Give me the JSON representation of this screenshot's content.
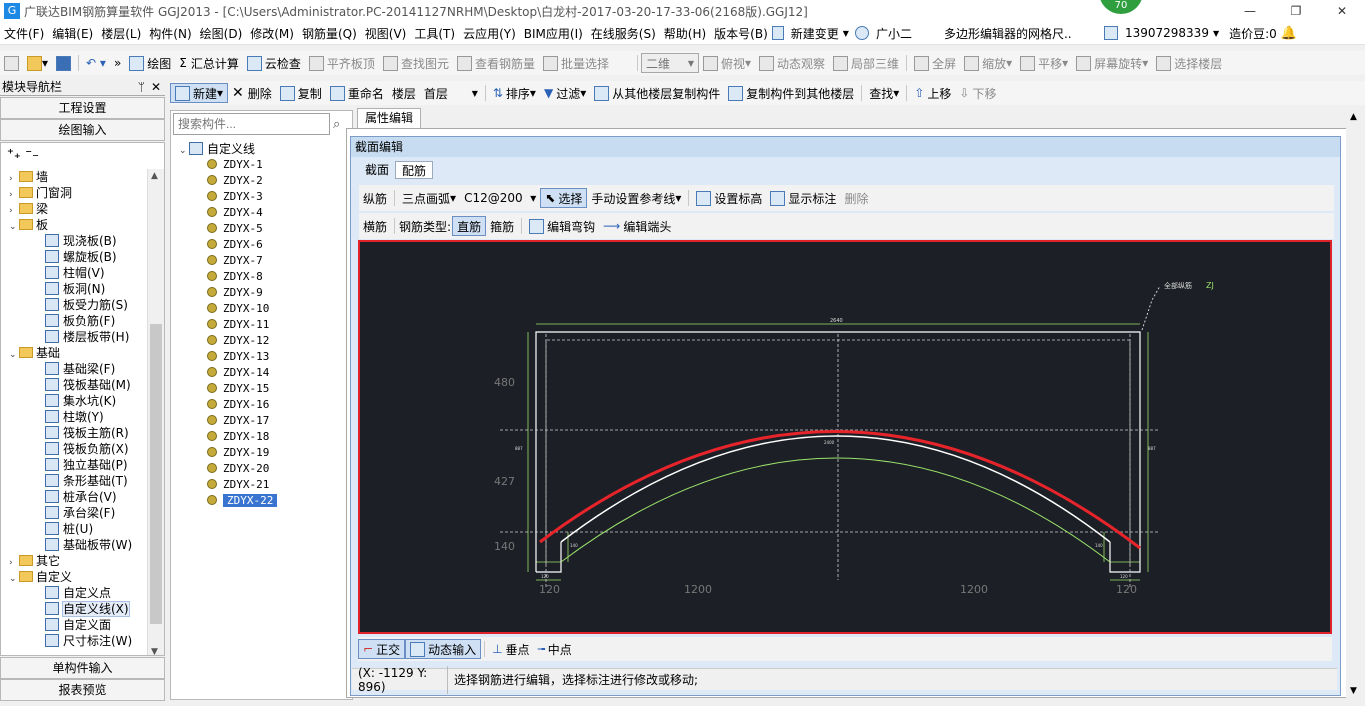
{
  "window": {
    "title": "广联达BIM钢筋算量软件 GGJ2013 - [C:\\Users\\Administrator.PC-20141127NRHM\\Desktop\\白龙村-2017-03-20-17-33-06(2168版).GGJ12]",
    "badge": "70",
    "min": "—",
    "restore": "❐",
    "close": "✕"
  },
  "menu": {
    "items": [
      "文件(F)",
      "编辑(E)",
      "楼层(L)",
      "构件(N)",
      "绘图(D)",
      "修改(M)",
      "钢筋量(Q)",
      "视图(V)",
      "工具(T)",
      "云应用(Y)",
      "BIM应用(I)",
      "在线服务(S)",
      "帮助(H)",
      "版本号(B)"
    ],
    "new_change": "新建变更",
    "assistant": "广小二",
    "marquee": "多边形编辑器的网格尺..",
    "phone": "13907298339",
    "beans": "造价豆:0"
  },
  "toolbar1": {
    "items": [
      "绘图",
      "汇总计算",
      "云检查",
      "平齐板顶",
      "查找图元",
      "查看钢筋量",
      "批量选择"
    ],
    "view_mode": "二维",
    "items2": [
      "俯视",
      "动态观察",
      "局部三维",
      "全屏",
      "缩放",
      "平移",
      "屏幕旋转",
      "选择楼层"
    ]
  },
  "toolbar2": {
    "new": "新建",
    "delete": "删除",
    "copy": "复制",
    "rename": "重命名",
    "floor_label": "楼层",
    "floor_value": "首层",
    "sort": "排序",
    "filter": "过滤",
    "copy_from": "从其他楼层复制构件",
    "copy_to": "复制构件到其他楼层",
    "find": "查找",
    "up": "上移",
    "down": "下移"
  },
  "nav": {
    "header": "模块导航栏",
    "pin": "ᛘ",
    "close": "✕",
    "btn_project": "工程设置",
    "btn_draw": "绘图输入",
    "btn_single": "单构件输入",
    "btn_report": "报表预览",
    "tree": [
      {
        "t": "f",
        "lvl": 0,
        "exp": "›",
        "label": "墙"
      },
      {
        "t": "f",
        "lvl": 0,
        "exp": "›",
        "label": "门窗洞"
      },
      {
        "t": "f",
        "lvl": 0,
        "exp": "›",
        "label": "梁"
      },
      {
        "t": "f",
        "lvl": 0,
        "exp": "⌄",
        "label": "板"
      },
      {
        "t": "l",
        "lvl": 1,
        "label": "现浇板(B)"
      },
      {
        "t": "l",
        "lvl": 1,
        "label": "螺旋板(B)"
      },
      {
        "t": "l",
        "lvl": 1,
        "label": "柱帽(V)"
      },
      {
        "t": "l",
        "lvl": 1,
        "label": "板洞(N)"
      },
      {
        "t": "l",
        "lvl": 1,
        "label": "板受力筋(S)"
      },
      {
        "t": "l",
        "lvl": 1,
        "label": "板负筋(F)"
      },
      {
        "t": "l",
        "lvl": 1,
        "label": "楼层板带(H)"
      },
      {
        "t": "f",
        "lvl": 0,
        "exp": "⌄",
        "label": "基础"
      },
      {
        "t": "l",
        "lvl": 1,
        "label": "基础梁(F)"
      },
      {
        "t": "l",
        "lvl": 1,
        "label": "筏板基础(M)"
      },
      {
        "t": "l",
        "lvl": 1,
        "label": "集水坑(K)"
      },
      {
        "t": "l",
        "lvl": 1,
        "label": "柱墩(Y)"
      },
      {
        "t": "l",
        "lvl": 1,
        "label": "筏板主筋(R)"
      },
      {
        "t": "l",
        "lvl": 1,
        "label": "筏板负筋(X)"
      },
      {
        "t": "l",
        "lvl": 1,
        "label": "独立基础(P)"
      },
      {
        "t": "l",
        "lvl": 1,
        "label": "条形基础(T)"
      },
      {
        "t": "l",
        "lvl": 1,
        "label": "桩承台(V)"
      },
      {
        "t": "l",
        "lvl": 1,
        "label": "承台梁(F)"
      },
      {
        "t": "l",
        "lvl": 1,
        "label": "桩(U)"
      },
      {
        "t": "l",
        "lvl": 1,
        "label": "基础板带(W)"
      },
      {
        "t": "f",
        "lvl": 0,
        "exp": "›",
        "label": "其它"
      },
      {
        "t": "f",
        "lvl": 0,
        "exp": "⌄",
        "label": "自定义"
      },
      {
        "t": "l",
        "lvl": 1,
        "label": "自定义点"
      },
      {
        "t": "l",
        "lvl": 1,
        "label": "自定义线(X)",
        "sel": true
      },
      {
        "t": "l",
        "lvl": 1,
        "label": "自定义面"
      },
      {
        "t": "l",
        "lvl": 1,
        "label": "尺寸标注(W)"
      }
    ]
  },
  "components": {
    "search_placeholder": "搜索构件...",
    "root": "自定义线",
    "items": [
      "ZDYX-1",
      "ZDYX-2",
      "ZDYX-3",
      "ZDYX-4",
      "ZDYX-5",
      "ZDYX-6",
      "ZDYX-7",
      "ZDYX-8",
      "ZDYX-9",
      "ZDYX-10",
      "ZDYX-11",
      "ZDYX-12",
      "ZDYX-13",
      "ZDYX-14",
      "ZDYX-15",
      "ZDYX-16",
      "ZDYX-17",
      "ZDYX-18",
      "ZDYX-19",
      "ZDYX-20",
      "ZDYX-21",
      "ZDYX-22"
    ],
    "selected": "ZDYX-22"
  },
  "editor": {
    "prop_tab": "属性编辑",
    "title": "截面编辑",
    "tab_section": "截面",
    "tab_rebar": "配筋",
    "row1": {
      "longitudinal": "纵筋",
      "arc_mode": "三点画弧",
      "rebar_spec": "C12@200",
      "select": "选择",
      "manual_ref": "手动设置参考线",
      "set_elev": "设置标高",
      "show_label": "显示标注",
      "delete": "删除"
    },
    "row2": {
      "transverse": "横筋",
      "type_label": "钢筋类型:",
      "straight": "直筋",
      "stirrup": "箍筋",
      "edit_hook": "编辑弯钩",
      "edit_end": "编辑端头"
    },
    "bottom": {
      "ortho": "正交",
      "dyn_input": "动态输入",
      "perp": "垂点",
      "mid": "中点"
    },
    "status": {
      "coord": "(X: -1129 Y: 896)",
      "message": "选择钢筋进行编辑，选择标注进行修改或移动;"
    }
  },
  "drawing": {
    "top_dim": "2640",
    "left_dims": [
      "480",
      "427",
      "140"
    ],
    "bottom_dims": [
      "120",
      "1200",
      "1200",
      "120"
    ],
    "callout_text": "全部纵筋",
    "callout_code": "ZJ",
    "small_dims": [
      "120",
      "120",
      "140",
      "140",
      "887",
      "887",
      "2400"
    ],
    "colors": {
      "bg": "#1d1f26",
      "rebar": "#e8242b",
      "line": "#ffffff",
      "dim": "#9be26b",
      "dash": "#cfcfcf"
    }
  }
}
